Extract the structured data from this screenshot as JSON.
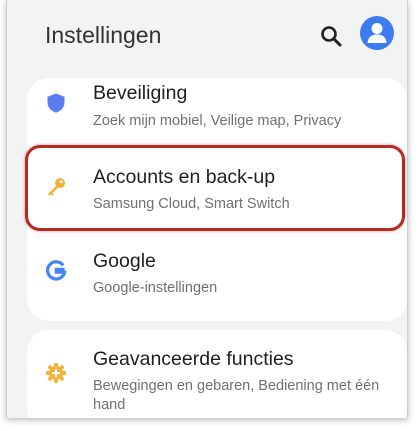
{
  "header": {
    "title": "Instellingen",
    "search_icon": "search-icon",
    "account_icon": "account-avatar-icon"
  },
  "settings": {
    "items": [
      {
        "label": "Beveiliging",
        "sub": "Zoek mijn mobiel, Veilige map, Privacy",
        "icon": "shield-icon",
        "icon_color": "#5b7cf0"
      },
      {
        "label": "Accounts en back-up",
        "sub": "Samsung Cloud, Smart Switch",
        "icon": "key-icon",
        "icon_color": "#f2b03b",
        "highlighted": true
      },
      {
        "label": "Google",
        "sub": "Google-instellingen",
        "icon": "google-g-icon",
        "icon_color": "#4285f4"
      },
      {
        "label": "Geavanceerde functies",
        "sub": "Bewegingen en gebaren, Bediening met één hand",
        "icon": "gear-plus-icon",
        "icon_color": "#f4b33a"
      }
    ]
  },
  "colors": {
    "highlight_border": "#b22a22",
    "accent_blue": "#3d7cf0",
    "background": "#f3f3f3"
  }
}
